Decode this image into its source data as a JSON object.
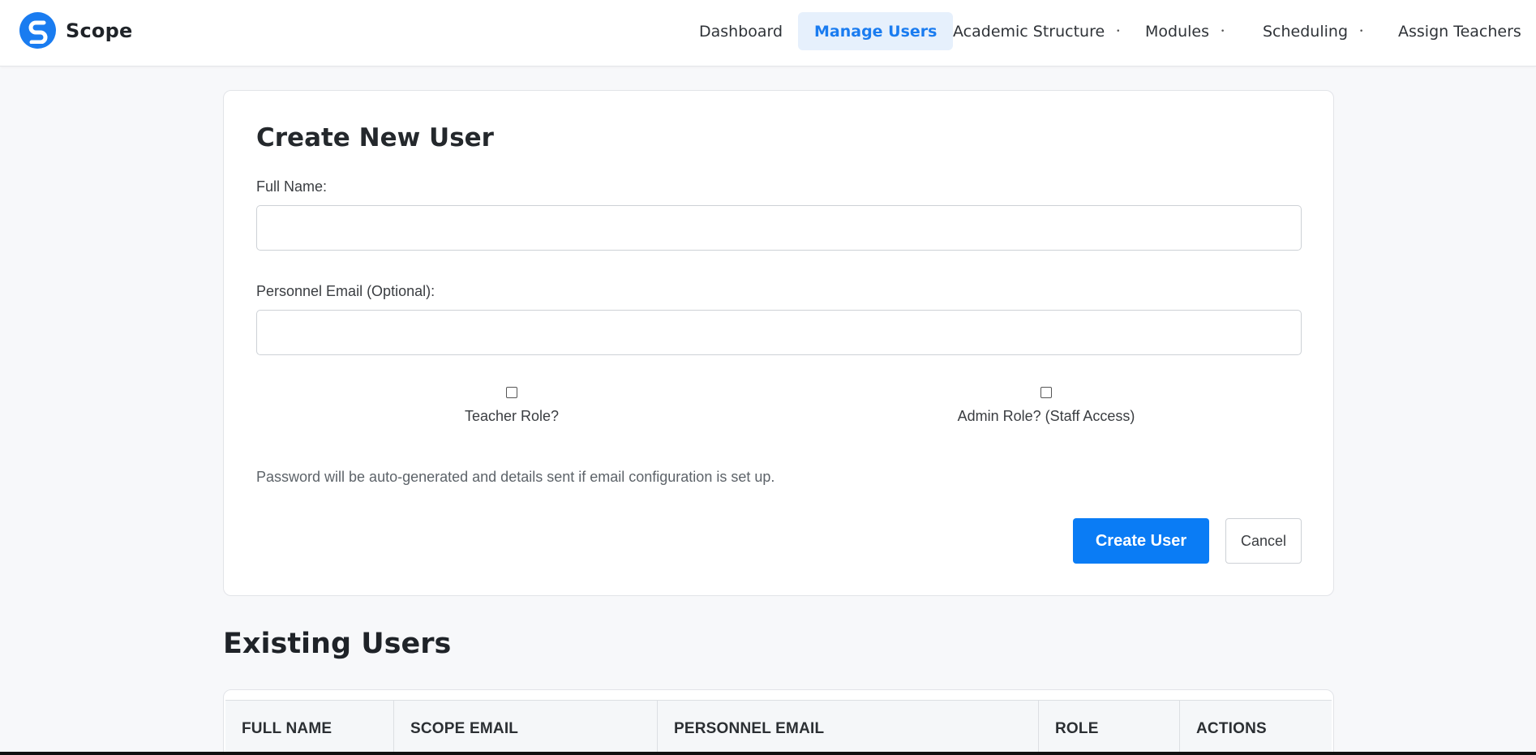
{
  "brand": {
    "name": "Scope",
    "logo_icon": "scope-s-logo-icon",
    "accent": "#1a7cf0"
  },
  "nav": {
    "items": [
      {
        "label": "Dashboard",
        "active": false,
        "dropdown": false
      },
      {
        "label": "Manage Users",
        "active": true,
        "dropdown": false
      },
      {
        "label": "Academic Structure",
        "active": false,
        "dropdown": true
      },
      {
        "label": "Modules",
        "active": false,
        "dropdown": true
      },
      {
        "label": "Scheduling",
        "active": false,
        "dropdown": true
      },
      {
        "label": "Assign Teachers",
        "active": false,
        "dropdown": false
      }
    ],
    "caret": "•"
  },
  "form": {
    "title": "Create New User",
    "full_name": {
      "label": "Full Name:",
      "value": "",
      "placeholder": ""
    },
    "personnel_email": {
      "label": "Personnel Email (Optional):",
      "value": "",
      "placeholder": ""
    },
    "teacher_role": {
      "label": "Teacher Role?",
      "checked": false
    },
    "admin_role": {
      "label": "Admin Role? (Staff Access)",
      "checked": false
    },
    "helper_text": "Password will be auto-generated and details sent if email configuration is set up.",
    "submit_label": "Create User",
    "cancel_label": "Cancel",
    "primary_color": "#0a7cf5"
  },
  "users": {
    "title": "Existing Users",
    "columns": [
      "FULL NAME",
      "SCOPE EMAIL",
      "PERSONNEL EMAIL",
      "ROLE",
      "ACTIONS"
    ]
  }
}
